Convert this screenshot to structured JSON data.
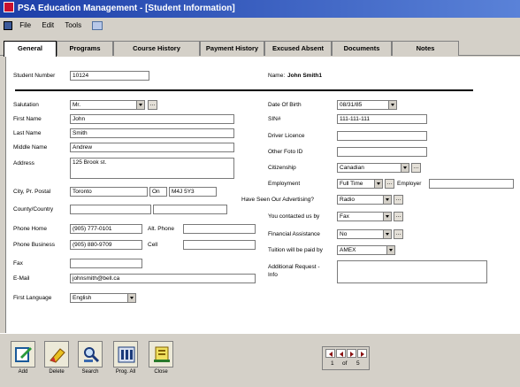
{
  "window": {
    "title": "PSA Education Management - [Student Information]"
  },
  "menu": [
    "File",
    "Edit",
    "Tools"
  ],
  "tabs": [
    "General",
    "Programs",
    "Course History",
    "Payment History",
    "Excused Absent",
    "Documents",
    "Notes"
  ],
  "header": {
    "student_number_label": "Student Number",
    "student_number_value": "10124",
    "name_label": "Name:",
    "name_value": "John Smith1"
  },
  "left": {
    "salutation": {
      "label": "Salutation",
      "value": "Mr."
    },
    "first_name": {
      "label": "First Name",
      "value": "John"
    },
    "last_name": {
      "label": "Last Name",
      "value": "Smith"
    },
    "middle_name": {
      "label": "Middle Name",
      "value": "Andrew"
    },
    "address": {
      "label": "Address",
      "value": "125 Brook st."
    },
    "city_pr_postal": {
      "label": "City, Pr. Postal",
      "city": "Toronto",
      "province": "On",
      "postal": "M4J 5Y3"
    },
    "county": {
      "label": "County/Country",
      "value": ""
    },
    "phone_home": {
      "label": "Phone Home",
      "value": "(905) 777-0101"
    },
    "alt_phone": {
      "label": "Alt. Phone",
      "value": ""
    },
    "phone_business": {
      "label": "Phone Business",
      "value": "(905) 880-9709"
    },
    "cell": {
      "label": "Cell",
      "value": ""
    },
    "fax": {
      "label": "Fax",
      "value": ""
    },
    "email": {
      "label": "E-Mail",
      "value": "johnsmith@bell.ca"
    },
    "first_language": {
      "label": "First Language",
      "value": "English"
    }
  },
  "right": {
    "dob": {
      "label": "Date Of Birth",
      "value": "08/31/85"
    },
    "sin": {
      "label": "SIN#",
      "value": "111-111-111"
    },
    "driver_licence": {
      "label": "Driver Licence",
      "value": ""
    },
    "other_foto_id": {
      "label": "Other Foto ID",
      "value": ""
    },
    "citizenship": {
      "label": "Citizenship",
      "value": "Canadian"
    },
    "employment": {
      "label": "Employment",
      "value": "Full Time",
      "employer_label": "Employer",
      "employer_value": ""
    },
    "advertising": {
      "label": "Have Seen Our Advertising?",
      "value": "Radio"
    },
    "contacted_by": {
      "label": "You contacted us by",
      "value": "Fax"
    },
    "financial": {
      "label": "Financial Assistance",
      "value": "No"
    },
    "tuition": {
      "label": "Tuition will be paid by",
      "value": "AMEX"
    },
    "additional": {
      "label_1": "Additional Request -",
      "label_2": "Info",
      "value": ""
    }
  },
  "toolbar": [
    "Add",
    "Delete",
    "Search",
    "Prog. All",
    "Close"
  ],
  "navigator": {
    "current": "1",
    "of_label": "of",
    "total": "5"
  }
}
